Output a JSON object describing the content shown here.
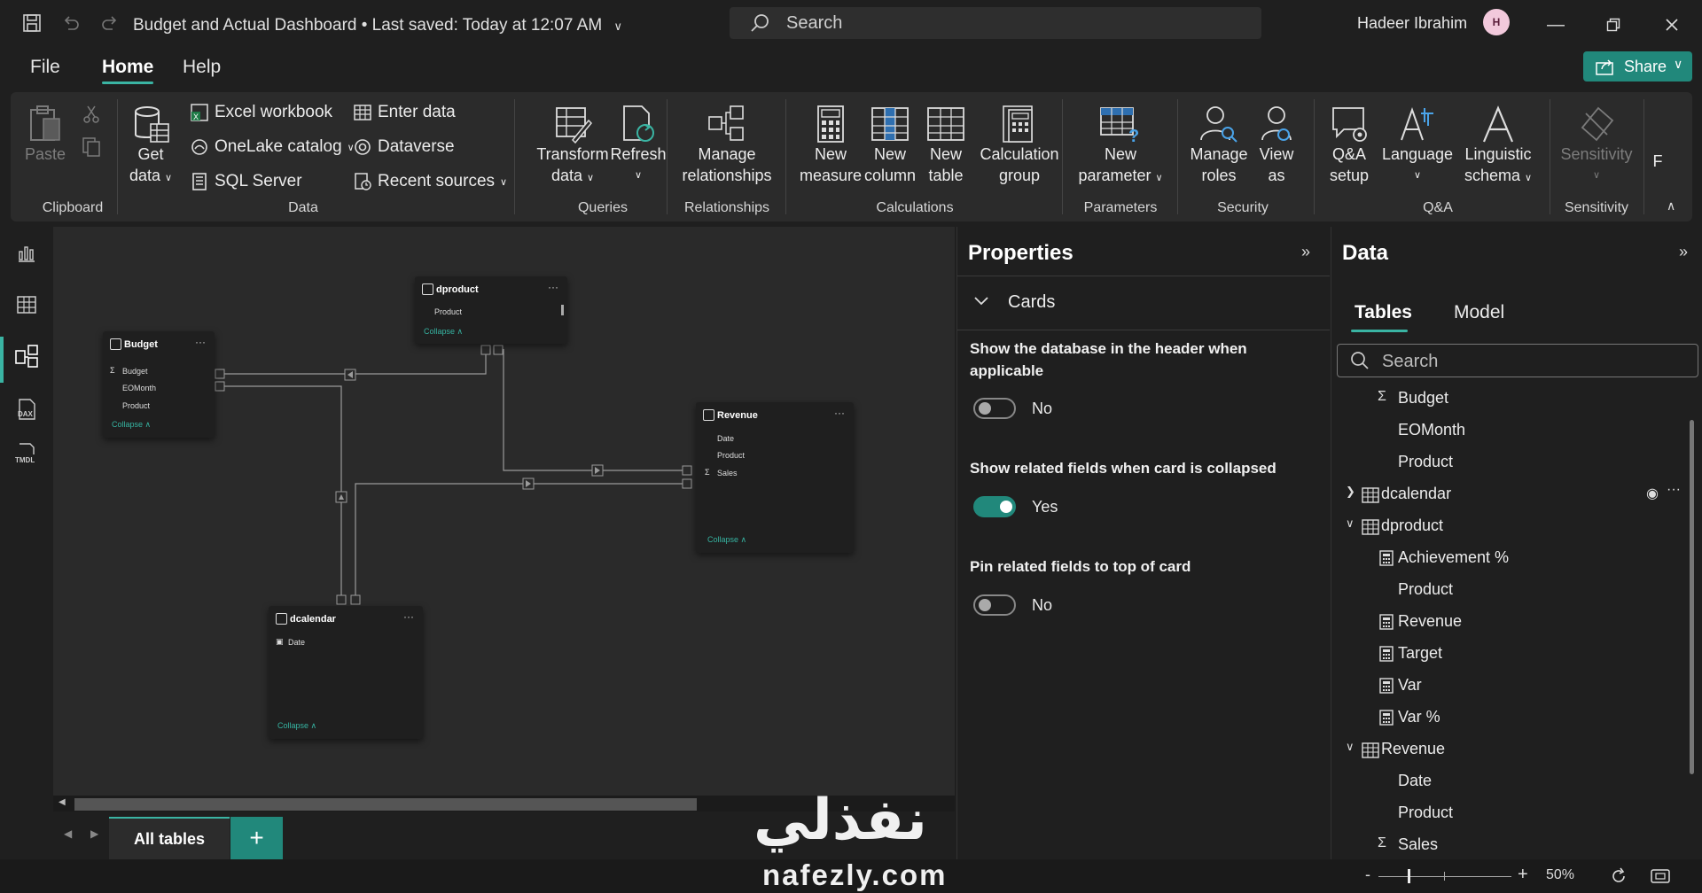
{
  "titlebar": {
    "doc_title": "Budget and Actual Dashboard • Last saved: Today at 12:07 AM",
    "search_placeholder": "Search",
    "user_name": "Hadeer Ibrahim",
    "avatar_initial": "H"
  },
  "menu": {
    "file": "File",
    "home": "Home",
    "help": "Help",
    "share": "Share"
  },
  "ribbon": {
    "paste": "Paste",
    "clipboard": "Clipboard",
    "get_data_1": "Get",
    "get_data_2": "data",
    "excel": "Excel workbook",
    "onelake": "OneLake catalog",
    "sql": "SQL Server",
    "enter_data": "Enter data",
    "dataverse": "Dataverse",
    "recent": "Recent sources",
    "data_group": "Data",
    "transform_1": "Transform",
    "transform_2": "data",
    "refresh": "Refresh",
    "queries": "Queries",
    "manage_rel_1": "Manage",
    "manage_rel_2": "relationships",
    "relationships": "Relationships",
    "new_measure_1": "New",
    "new_measure_2": "measure",
    "new_column_1": "New",
    "new_column_2": "column",
    "new_table_1": "New",
    "new_table_2": "table",
    "calc_group_1": "Calculation",
    "calc_group_2": "group",
    "calculations": "Calculations",
    "new_param_1": "New",
    "new_param_2": "parameter",
    "parameters": "Parameters",
    "manage_roles_1": "Manage",
    "manage_roles_2": "roles",
    "view_as_1": "View",
    "view_as_2": "as",
    "security": "Security",
    "qa_setup_1": "Q&A",
    "qa_setup_2": "setup",
    "language": "Language",
    "ling_1": "Linguistic",
    "ling_2": "schema",
    "qa": "Q&A",
    "sensitivity_btn": "Sensitivity",
    "sensitivity": "Sensitivity",
    "overflow": "F"
  },
  "model": {
    "dproduct": {
      "title": "dproduct",
      "fields": [
        "Product"
      ],
      "collapse": "Collapse"
    },
    "budget": {
      "title": "Budget",
      "fields": [
        "Budget",
        "EOMonth",
        "Product"
      ],
      "collapse": "Collapse"
    },
    "revenue": {
      "title": "Revenue",
      "fields": [
        "Date",
        "Product",
        "Sales"
      ],
      "collapse": "Collapse"
    },
    "dcalendar": {
      "title": "dcalendar",
      "fields": [
        "Date"
      ],
      "collapse": "Collapse"
    },
    "tab_all": "All tables",
    "tab_add": "+"
  },
  "properties": {
    "title": "Properties",
    "section": "Cards",
    "p1_label": "Show the database in the header when applicable",
    "p1_value": "No",
    "p2_label": "Show related fields when card is collapsed",
    "p2_value": "Yes",
    "p3_label": "Pin related fields to top of card",
    "p3_value": "No"
  },
  "data_pane": {
    "title": "Data",
    "tab_tables": "Tables",
    "tab_model": "Model",
    "search_placeholder": "Search",
    "items": [
      {
        "icon": "sigma-icon",
        "label": "Budget"
      },
      {
        "icon": "",
        "label": "EOMonth"
      },
      {
        "icon": "",
        "label": "Product"
      },
      {
        "icon": "calendar-table-icon",
        "label": "dcalendar"
      },
      {
        "icon": "table-icon",
        "label": "dproduct"
      },
      {
        "icon": "measure-icon",
        "label": "Achievement %"
      },
      {
        "icon": "",
        "label": "Product"
      },
      {
        "icon": "measure-icon",
        "label": "Revenue"
      },
      {
        "icon": "measure-icon",
        "label": "Target"
      },
      {
        "icon": "measure-icon",
        "label": "Var"
      },
      {
        "icon": "measure-icon",
        "label": "Var %"
      },
      {
        "icon": "table-icon",
        "label": "Revenue"
      },
      {
        "icon": "",
        "label": "Date"
      },
      {
        "icon": "",
        "label": "Product"
      },
      {
        "icon": "sigma-icon",
        "label": "Sales"
      }
    ]
  },
  "status": {
    "zoom": "50%"
  },
  "watermark": {
    "arabic": "نفذلي",
    "latin": "nafezly.com"
  },
  "colors": {
    "accent": "#21887b",
    "accent_light": "#3ab4a3",
    "background": "#1f1f1f",
    "canvas": "#2a2a2a"
  }
}
